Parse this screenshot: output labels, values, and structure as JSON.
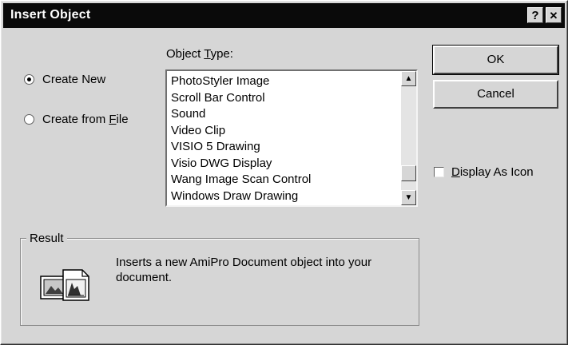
{
  "window": {
    "title": "Insert Object",
    "help_button": "?",
    "close_button": "✕"
  },
  "mode": {
    "create_new": {
      "prefix": "",
      "access_key": "",
      "label": "Create New",
      "selected": true
    },
    "create_from_file": {
      "prefix": "Create from ",
      "access_key": "F",
      "suffix": "ile",
      "selected": false
    }
  },
  "object_type": {
    "label_prefix": "Object ",
    "access_key": "T",
    "label_suffix": "ype:",
    "items": [
      "PhotoStyler Image",
      "Scroll Bar Control",
      "Sound",
      "Video Clip",
      "VISIO 5 Drawing",
      "Visio DWG Display",
      "Wang Image Scan Control",
      "Windows Draw Drawing"
    ],
    "scroll_up_glyph": "▲",
    "scroll_down_glyph": "▼"
  },
  "buttons": {
    "ok": "OK",
    "cancel": "Cancel"
  },
  "display_as_icon": {
    "access_key": "D",
    "label_suffix": "isplay As Icon",
    "checked": false
  },
  "result": {
    "label": "Result",
    "text": "Inserts a new AmiPro Document object into your document.",
    "icon": "document-object-icon"
  }
}
